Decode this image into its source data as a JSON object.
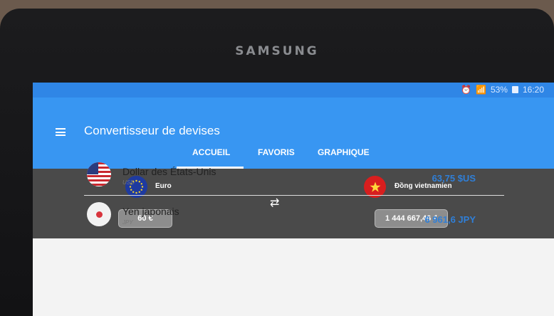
{
  "device": {
    "brand": "SAMSUNG"
  },
  "status_bar": {
    "battery": "53%",
    "time": "16:20"
  },
  "app": {
    "title": "Convertisseur de devises"
  },
  "tabs": [
    {
      "label": "ACCUEIL",
      "active": true
    },
    {
      "label": "FAVORIS"
    },
    {
      "label": "GRAPHIQUE"
    }
  ],
  "converter": {
    "from": {
      "name": "Euro",
      "amount": "60 €"
    },
    "to": {
      "name": "Đồng vietnamien",
      "amount": "1 444 667,46 ₫"
    }
  },
  "list": [
    {
      "name": "Dollar des États-Unis",
      "code": "USD",
      "value": "63,75 $US"
    },
    {
      "name": "Yen japonais",
      "code": "JPY",
      "value": "6 961,6 JPY"
    }
  ],
  "colors": {
    "accent": "#3896f2",
    "status": "#2f86e6",
    "value_text": "#2f7fd8"
  }
}
